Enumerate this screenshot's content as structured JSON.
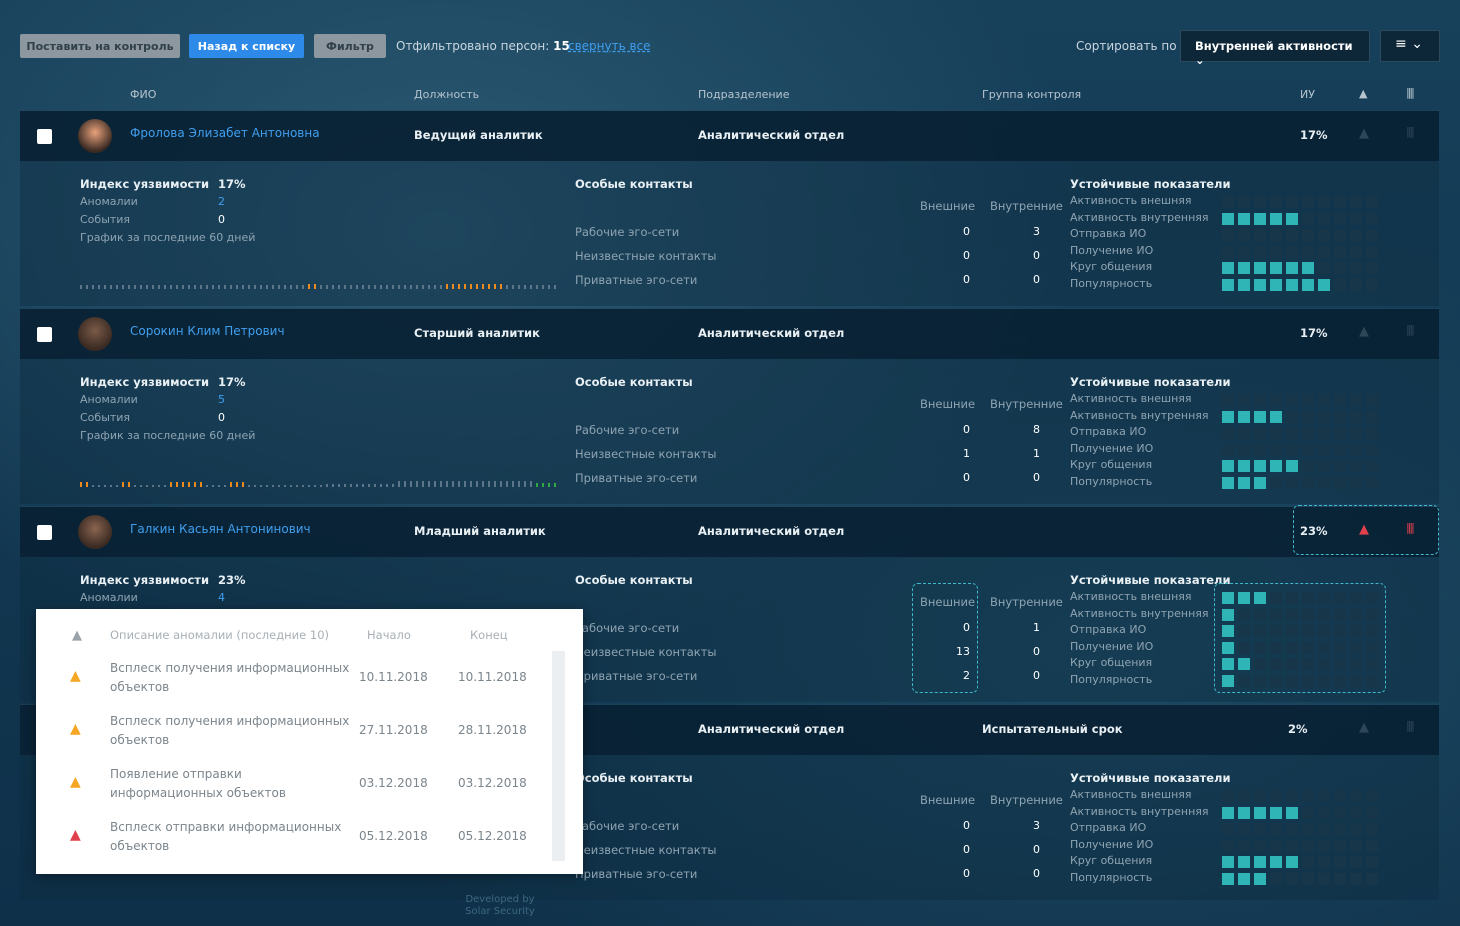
{
  "toolbar": {
    "control_btn": "Поставить на контроль",
    "back_btn": "Назад к списку",
    "filter_btn": "Фильтр",
    "filtered_label": "Отфильтровано персон:",
    "filtered_count": "15",
    "collapse_link": "свернуть все",
    "sort_label": "Сортировать по",
    "sort_value": "Внутренней активности"
  },
  "columns": {
    "fio": "ФИО",
    "position": "Должность",
    "department": "Подразделение",
    "group": "Группа контроля",
    "iu": "ИУ"
  },
  "labels": {
    "vuln_index": "Индекс уязвимости",
    "anomalies": "Аномалии",
    "events": "События",
    "chart_60": "График за последние 60 дней",
    "special_contacts": "Особые контакты",
    "external": "Внешние",
    "internal": "Внутренние",
    "work_ego": "Рабочие эго-сети",
    "unknown_contacts": "Неизвестные контакты",
    "private_ego": "Приватные эго-сети",
    "stable": "Устойчивые показатели",
    "act_ext": "Активность внешняя",
    "act_int": "Активность внутренняя",
    "send_io": "Отправка ИО",
    "recv_io": "Получение ИО",
    "circle": "Круг общения",
    "popularity": "Популярность"
  },
  "persons": [
    {
      "name": "Фролова Элизабет Антоновна",
      "position": "Ведущий аналитик",
      "department": "Аналитический отдел",
      "group": "",
      "iu": "17%",
      "vuln": "17%",
      "anomalies": "2",
      "events": "0",
      "contacts": {
        "work": [
          "0",
          "3"
        ],
        "unknown": [
          "0",
          "0"
        ],
        "private": [
          "0",
          "0"
        ]
      },
      "bars": [
        0,
        5,
        0,
        0,
        6,
        7
      ]
    },
    {
      "name": "Сорокин Клим Петрович",
      "position": "Старший аналитик",
      "department": "Аналитический отдел",
      "group": "",
      "iu": "17%",
      "vuln": "17%",
      "anomalies": "5",
      "events": "0",
      "contacts": {
        "work": [
          "0",
          "8"
        ],
        "unknown": [
          "1",
          "1"
        ],
        "private": [
          "0",
          "0"
        ]
      },
      "bars": [
        0,
        4,
        0,
        0,
        5,
        3
      ]
    },
    {
      "name": "Галкин Касьян Антонинович",
      "position": "Младший аналитик",
      "department": "Аналитический отдел",
      "group": "",
      "iu": "23%",
      "vuln": "23%",
      "anomalies": "4",
      "events": "",
      "contacts": {
        "work": [
          "0",
          "1"
        ],
        "unknown": [
          "13",
          "0"
        ],
        "private": [
          "2",
          "0"
        ]
      },
      "bars": [
        3,
        1,
        1,
        1,
        2,
        1
      ]
    },
    {
      "name": "",
      "position": "",
      "department": "Аналитический отдел",
      "group": "Испытательный срок",
      "iu": "2%",
      "vuln": "",
      "anomalies": "",
      "events": "",
      "contacts": {
        "work": [
          "0",
          "3"
        ],
        "unknown": [
          "0",
          "0"
        ],
        "private": [
          "0",
          "0"
        ]
      },
      "bars": [
        0,
        5,
        0,
        0,
        5,
        3
      ]
    }
  ],
  "popup": {
    "col_desc": "Описание аномалии (последние 10)",
    "col_start": "Начало",
    "col_end": "Конец",
    "rows": [
      {
        "desc": "Всплеск получения информационных объектов",
        "start": "10.11.2018",
        "end": "10.11.2018",
        "level": "warning"
      },
      {
        "desc": "Всплеск получения информационных объектов",
        "start": "27.11.2018",
        "end": "28.11.2018",
        "level": "warning"
      },
      {
        "desc": "Появление отправки информационных объектов",
        "start": "03.12.2018",
        "end": "03.12.2018",
        "level": "warning"
      },
      {
        "desc": "Всплеск отправки информационных объектов",
        "start": "05.12.2018",
        "end": "05.12.2018",
        "level": "danger"
      }
    ]
  },
  "footer": {
    "line1": "Developed by",
    "line2": "Solar Security"
  },
  "colors": {
    "accent": "#2e8ae8",
    "teal": "#2fb5b5",
    "orange": "#f08a1c",
    "danger": "#e0404c",
    "warning": "#f5a623"
  }
}
